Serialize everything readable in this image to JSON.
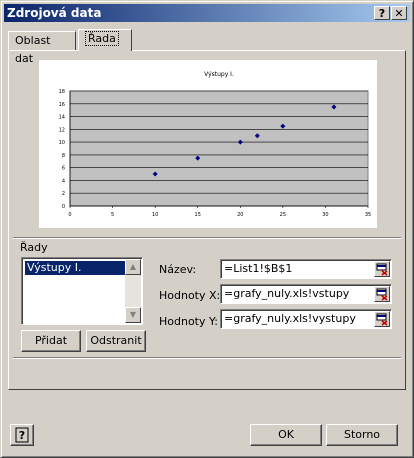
{
  "window": {
    "title": "Zdrojová data",
    "help_btn": "?",
    "close_btn": "✕"
  },
  "tabs": [
    {
      "label": "Oblast dat",
      "active": false
    },
    {
      "label": "Řada",
      "active": true
    }
  ],
  "chart_data": {
    "type": "scatter",
    "title": "Výstupy I.",
    "xlabel": "",
    "ylabel": "",
    "x": [
      10,
      15,
      20,
      22,
      25,
      31
    ],
    "y": [
      5,
      7.5,
      10,
      11,
      12.5,
      15.5
    ],
    "xlim": [
      0,
      35
    ],
    "ylim": [
      0,
      18
    ],
    "xticks": [
      "0",
      "5",
      "10",
      "15",
      "20",
      "25",
      "30",
      "35"
    ],
    "yticks": [
      "0",
      "2",
      "4",
      "6",
      "8",
      "10",
      "12",
      "14",
      "16",
      "18"
    ],
    "grid": true,
    "plot_color": "#c0c0c0",
    "marker_color": "#000080"
  },
  "series_group": {
    "label": "Řady",
    "items": [
      "Výstupy I."
    ],
    "add_label": "Přidat",
    "remove_label": "Odstranit"
  },
  "fields": {
    "name": {
      "label": "Název:",
      "value": "=List1!$B$1"
    },
    "x_values": {
      "label": "Hodnoty X:",
      "value": "=grafy_nuly.xls!vstupy"
    },
    "y_values": {
      "label": "Hodnoty Y:",
      "value": "=grafy_nuly.xls!vystupy"
    }
  },
  "footer": {
    "ok_label": "OK",
    "cancel_label": "Storno"
  }
}
